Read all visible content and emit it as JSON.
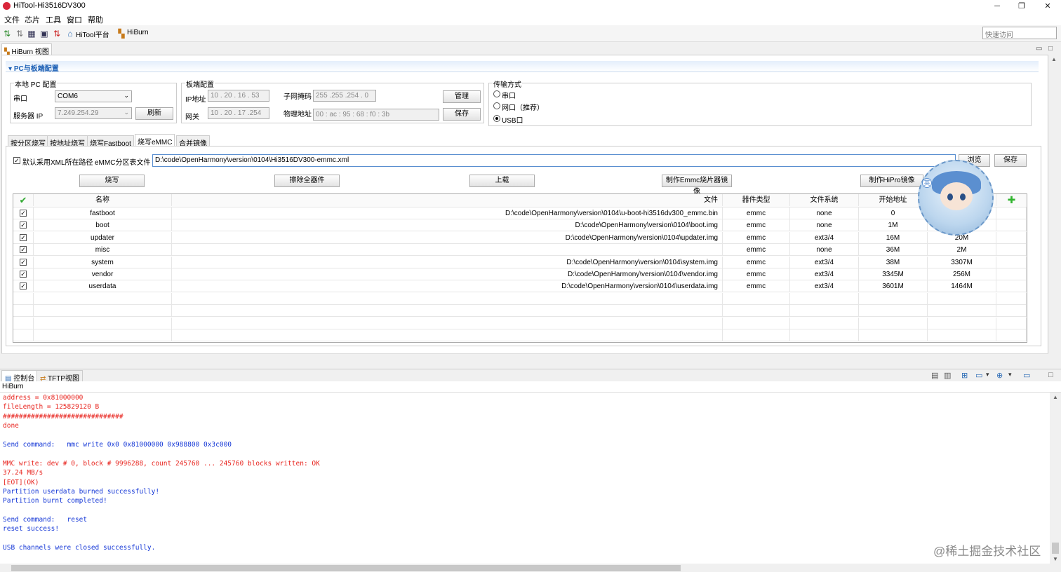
{
  "window": {
    "title": "HiTool-Hi3516DV300",
    "minimize": "─",
    "maximize": "❐",
    "close": "✕"
  },
  "menu": [
    "文件",
    "芯片",
    "工具",
    "窗口",
    "帮助"
  ],
  "toolbar": {
    "platform": "HiTool平台",
    "hiburn": "HiBurn",
    "quick_access": "快速访问"
  },
  "view_tab": "HiBurn 视图",
  "section_title": "PC与板端配置",
  "local_pc": {
    "title": "本地 PC 配置",
    "serial_label": "串口",
    "serial_value": "COM6",
    "server_ip_label": "服务器 IP",
    "server_ip_value": "7.249.254.29",
    "refresh": "刷新"
  },
  "board": {
    "title": "板端配置",
    "ip_label": "IP地址",
    "ip_value": "10 . 20 . 16 . 53",
    "gateway_label": "网关",
    "gateway_value": "10 . 20 . 17 .254",
    "mask_label": "子网掩码",
    "mask_value": "255 .255 .254 . 0",
    "mac_label": "物理地址",
    "mac_value": "00 : ac : 95 : 68 : f0 : 3b",
    "manage": "管理",
    "save": "保存"
  },
  "transfer": {
    "title": "传输方式",
    "options": [
      "串口",
      "网口（推荐）",
      "USB口"
    ],
    "selected": "USB口"
  },
  "subtabs": [
    "按分区烧写",
    "按地址烧写",
    "烧写Fastboot",
    "烧写eMMC",
    "合并镜像"
  ],
  "active_subtab": "烧写eMMC",
  "xml": {
    "checkbox_label": "默认采用XML所在路径",
    "file_label": "eMMC分区表文件",
    "path": "D:\\code\\OpenHarmony\\version\\0104\\Hi3516DV300-emmc.xml",
    "browse": "浏览",
    "save": "保存"
  },
  "actions": {
    "burn": "烧写",
    "erase": "擦除全器件",
    "upload": "上载",
    "make_emmc": "制作Emmc烧片器镜像",
    "make_hipro": "制作HiPro镜像"
  },
  "table": {
    "headers": {
      "check": "✔",
      "name": "名称",
      "file": "文件",
      "device": "器件类型",
      "fs": "文件系统",
      "start": "开始地址",
      "length": "",
      "add": "✚"
    },
    "rows": [
      {
        "checked": "✓",
        "name": "fastboot",
        "file": "D:\\code\\OpenHarmony\\version\\0104\\u-boot-hi3516dv300_emmc.bin",
        "device": "emmc",
        "fs": "none",
        "start": "0",
        "length": ""
      },
      {
        "checked": "✓",
        "name": "boot",
        "file": "D:\\code\\OpenHarmony\\version\\0104\\boot.img",
        "device": "emmc",
        "fs": "none",
        "start": "1M",
        "length": ""
      },
      {
        "checked": "✓",
        "name": "updater",
        "file": "D:\\code\\OpenHarmony\\version\\0104\\updater.img",
        "device": "emmc",
        "fs": "ext3/4",
        "start": "16M",
        "length": "20M"
      },
      {
        "checked": "✓",
        "name": "misc",
        "file": "",
        "device": "emmc",
        "fs": "none",
        "start": "36M",
        "length": "2M"
      },
      {
        "checked": "✓",
        "name": "system",
        "file": "D:\\code\\OpenHarmony\\version\\0104\\system.img",
        "device": "emmc",
        "fs": "ext3/4",
        "start": "38M",
        "length": "3307M"
      },
      {
        "checked": "✓",
        "name": "vendor",
        "file": "D:\\code\\OpenHarmony\\version\\0104\\vendor.img",
        "device": "emmc",
        "fs": "ext3/4",
        "start": "3345M",
        "length": "256M"
      },
      {
        "checked": "✓",
        "name": "userdata",
        "file": "D:\\code\\OpenHarmony\\version\\0104\\userdata.img",
        "device": "emmc",
        "fs": "ext3/4",
        "start": "3601M",
        "length": "1464M"
      }
    ]
  },
  "console_tabs": [
    "控制台",
    "TFTP视图"
  ],
  "console_header": "HiBurn",
  "console_lines": [
    {
      "text": "address = 0x81000000",
      "color": "red"
    },
    {
      "text": "fileLength = 125829120 B",
      "color": "red"
    },
    {
      "text": "##############################",
      "color": "red"
    },
    {
      "text": "done",
      "color": "red"
    },
    {
      "text": "",
      "color": "blue"
    },
    {
      "text": "Send command:   mmc write 0x0 0x81000000 0x988800 0x3c000",
      "color": "blue"
    },
    {
      "text": "",
      "color": "blue"
    },
    {
      "text": "MMC write: dev # 0, block # 9996288, count 245760 ... 245760 blocks written: OK",
      "color": "red"
    },
    {
      "text": "37.24 MB/s",
      "color": "red"
    },
    {
      "text": "[EOT](OK)",
      "color": "red"
    },
    {
      "text": "Partition userdata burned successfully!",
      "color": "blue"
    },
    {
      "text": "Partition burnt completed!",
      "color": "blue"
    },
    {
      "text": "",
      "color": "blue"
    },
    {
      "text": "Send command:   reset",
      "color": "blue"
    },
    {
      "text": "reset success!",
      "color": "blue"
    },
    {
      "text": "",
      "color": "blue"
    },
    {
      "text": "USB channels were closed successfully.",
      "color": "blue"
    }
  ],
  "avatar_badge": "英",
  "watermark": "@稀土掘金技术社区",
  "colors": {
    "accent_blue": "#1b5fb5",
    "console_red": "#e8251f",
    "console_blue": "#1336d6",
    "check_green": "#2fa82f",
    "add_green": "#31b52f"
  }
}
